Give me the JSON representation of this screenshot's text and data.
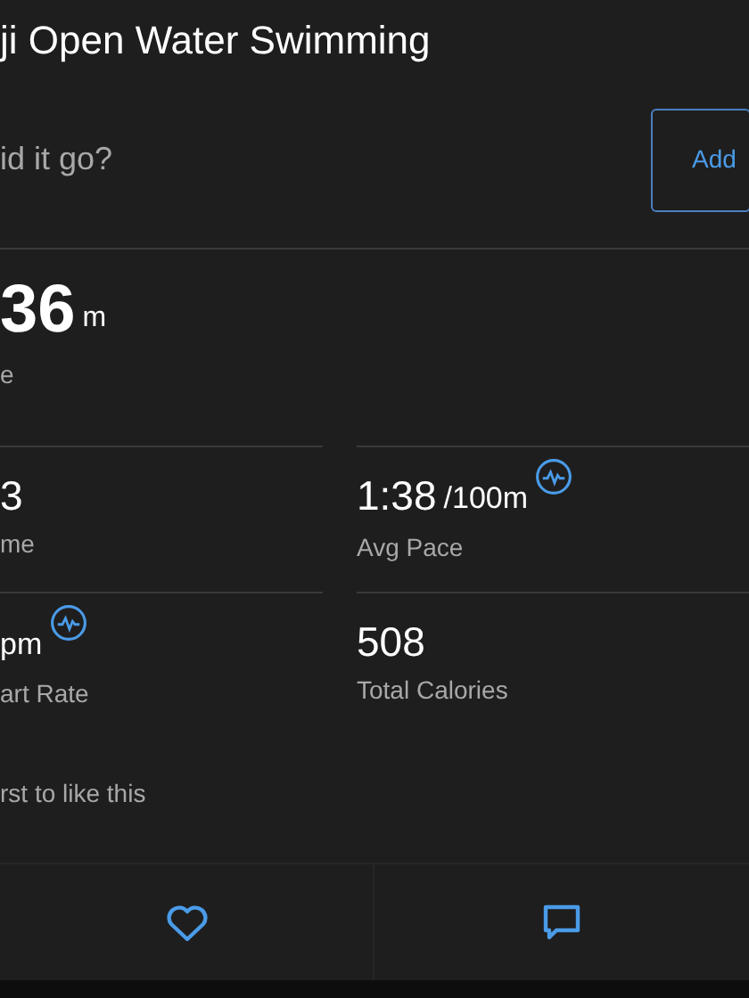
{
  "title": "ji Open Water Swimming",
  "notes": {
    "prompt": "id it go?",
    "button": "Add"
  },
  "distance": {
    "value": "36",
    "unit": "m",
    "label": "e"
  },
  "stats": [
    {
      "value": "3",
      "label": "me",
      "chart_link": false
    },
    {
      "value": "1:38",
      "unit": "/100m",
      "label": "Avg Pace",
      "chart_link": true
    },
    {
      "unit": "pm",
      "label": "art Rate",
      "chart_link": true
    },
    {
      "value": "508",
      "label": "Total Calories",
      "chart_link": false
    }
  ],
  "likes": "rst to like this",
  "actions": [
    {
      "kind": "like"
    },
    {
      "kind": "comment"
    }
  ]
}
